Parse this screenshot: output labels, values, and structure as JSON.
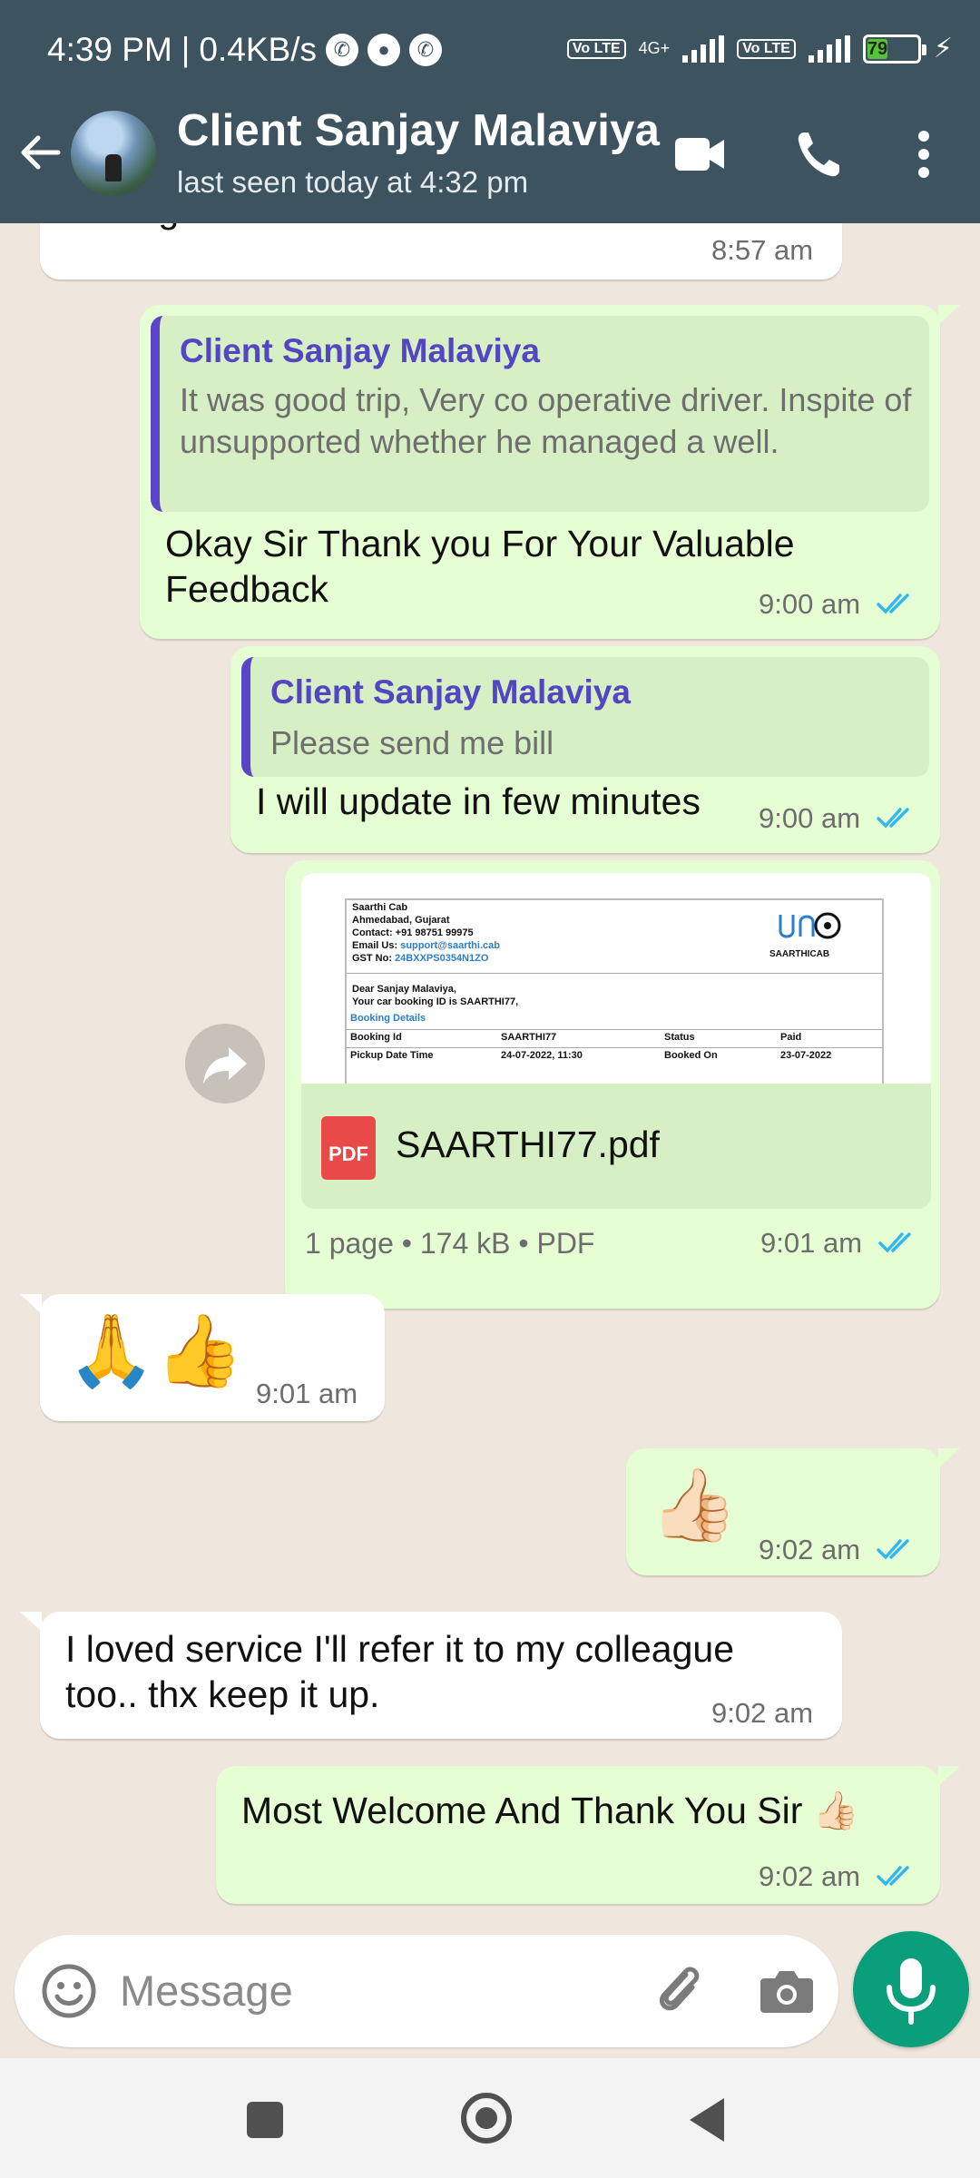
{
  "status_bar": {
    "time": "4:39 PM",
    "speed": "0.4KB/s",
    "volte1": "Vo LTE",
    "network": "4G+",
    "volte2": "Vo LTE",
    "battery": "79"
  },
  "header": {
    "contact_name": "Client Sanjay Malaviya",
    "last_seen": "last seen today at 4:32 pm"
  },
  "messages": {
    "m0": {
      "text": "managed a well.",
      "time": "8:57 am"
    },
    "m1": {
      "quote_name": "Client Sanjay Malaviya",
      "quote_text": "It was good trip, Very co operative driver. Inspite of unsupported whether he managed a well.",
      "text": "Okay Sir Thank you For Your Valuable Feedback",
      "time": "9:00 am"
    },
    "m2": {
      "quote_name": "Client Sanjay Malaviya",
      "quote_text": "Please send me bill",
      "text": "I will update in few minutes",
      "time": "9:00 am"
    },
    "m3": {
      "doc": {
        "company": "Saarthi Cab",
        "city": "Ahmedabad, Gujarat",
        "contact": "Contact: +91 98751 99975",
        "email_label": "Email Us:",
        "email": "support@saarthi.cab",
        "gst_label": "GST No:",
        "gst": "24BXXPS0354N1ZO",
        "logo_text": "SAARTHICAB",
        "greeting": "Dear Sanjay Malaviya,",
        "booking_line": "Your car booking ID is SAARTHI77,",
        "section": "Booking Details",
        "row1": [
          "Booking Id",
          "SAARTHI77",
          "Status",
          "Paid"
        ],
        "row2": [
          "Pickup Date Time",
          "24-07-2022, 11:30",
          "Booked On",
          "23-07-2022"
        ]
      },
      "pdf_badge": "PDF",
      "file_name": "SAARTHI77.pdf",
      "meta": "1 page • 174 kB • PDF",
      "time": "9:01 am"
    },
    "m4": {
      "emoji": "🙏👍",
      "time": "9:01 am"
    },
    "m5": {
      "emoji": "👍🏻",
      "time": "9:02 am"
    },
    "m6": {
      "text": "I loved service I'll refer it to my colleague too.. thx keep it up.",
      "time": "9:02 am"
    },
    "m7": {
      "text": "Most Welcome And Thank You Sir 👍🏻",
      "time": "9:02 am"
    }
  },
  "composer": {
    "placeholder": "Message"
  },
  "colors": {
    "header": "#3d5360",
    "outgoing": "#e6fed4",
    "incoming": "#ffffff",
    "read_ticks": "#34b7f1",
    "mic": "#0a9e7b"
  }
}
